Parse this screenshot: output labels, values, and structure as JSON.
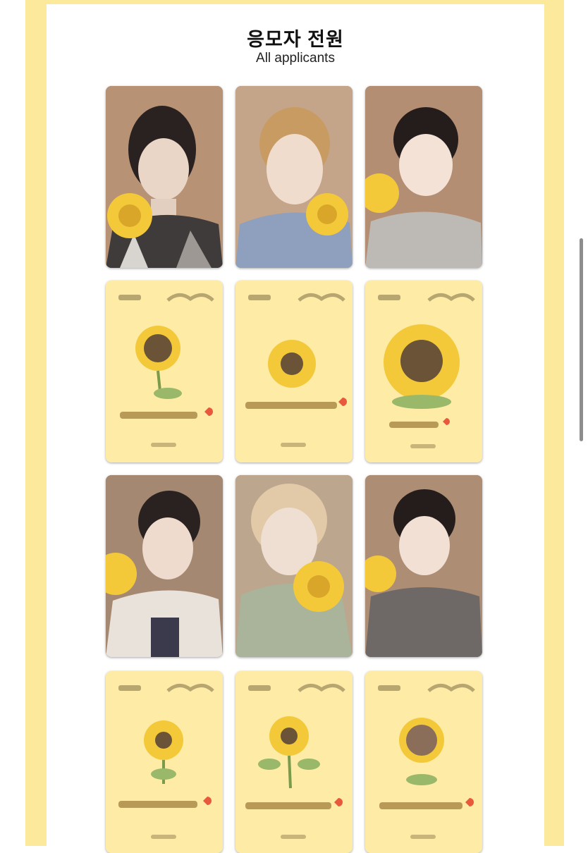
{
  "header": {
    "title": "응모자 전원",
    "subtitle": "All applicants"
  },
  "cards": [
    {
      "kind": "photo"
    },
    {
      "kind": "photo"
    },
    {
      "kind": "photo"
    },
    {
      "kind": "card-back"
    },
    {
      "kind": "card-back"
    },
    {
      "kind": "card-back"
    },
    {
      "kind": "photo"
    },
    {
      "kind": "photo"
    },
    {
      "kind": "photo"
    },
    {
      "kind": "card-back"
    },
    {
      "kind": "card-back"
    },
    {
      "kind": "card-back"
    }
  ],
  "colors": {
    "frame": "#fde99b",
    "card_back": "#fdeba6",
    "sunflower_petal": "#f3c93a",
    "sunflower_center": "#6b5338",
    "heart": "#e8583a"
  }
}
